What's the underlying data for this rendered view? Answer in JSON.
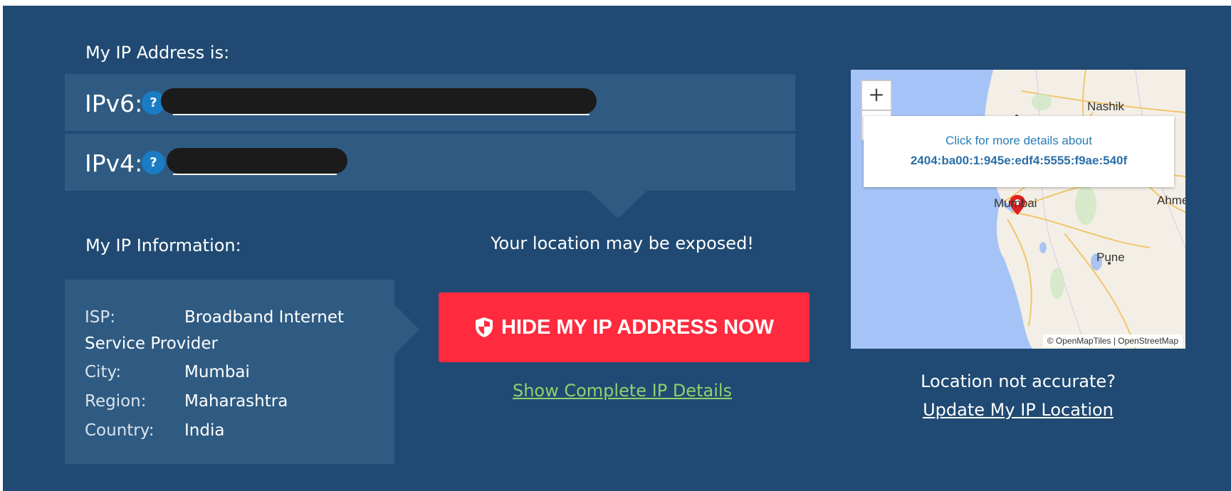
{
  "ip_section": {
    "heading": "My IP Address is:",
    "ipv6_label": "IPv6:",
    "ipv4_label": "IPv4:",
    "help_glyph": "?"
  },
  "info_section": {
    "heading": "My IP Information:",
    "rows": [
      {
        "key": "ISP:",
        "value": "Broadband Internet",
        "cont": "Service Provider"
      },
      {
        "key": "City:",
        "value": "Mumbai"
      },
      {
        "key": "Region:",
        "value": "Maharashtra"
      },
      {
        "key": "Country:",
        "value": "India"
      }
    ]
  },
  "warning": "Your location may be exposed!",
  "cta": {
    "label": "HIDE MY IP ADDRESS NOW",
    "icon": "shield-icon",
    "color": "#ff2a3d"
  },
  "show_details_link": "Show Complete IP Details",
  "map": {
    "zoom_in": "+",
    "zoom_out": "−",
    "popup_line1": "Click for more details about",
    "popup_ip": "2404:ba00:1:945e:edf4:5555:f9ae:540f",
    "cities": [
      "Nashik",
      "Mumbai",
      "Ahme",
      "Pune"
    ],
    "attribution": "© OpenMapTiles | OpenStreetMap",
    "marker_color": "#e02020"
  },
  "location": {
    "question": "Location not accurate?",
    "update_link": "Update My IP Location"
  },
  "colors": {
    "background": "#204a73",
    "box": "#2f5b82",
    "link_green": "#8ed26e"
  }
}
